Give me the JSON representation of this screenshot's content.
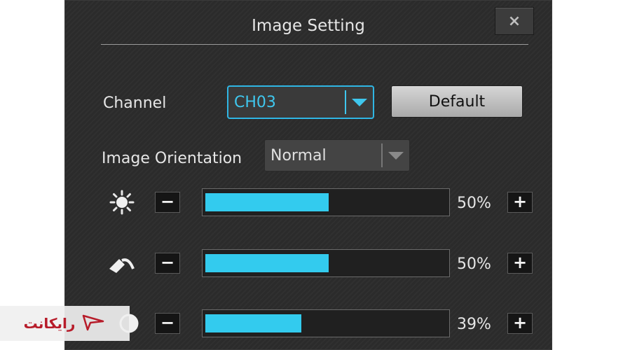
{
  "dialog": {
    "title": "Image Setting",
    "close_label": "×"
  },
  "channel": {
    "label": "Channel",
    "selected": "CH03",
    "default_button": "Default"
  },
  "orientation": {
    "label": "Image Orientation",
    "selected": "Normal"
  },
  "adjustments": [
    {
      "icon": "brightness-sun-icon",
      "percent_label": "50%",
      "level": 0.5,
      "minus": "−",
      "plus": "+"
    },
    {
      "icon": "contrast-icon",
      "percent_label": "50%",
      "level": 0.5,
      "minus": "−",
      "plus": "+"
    },
    {
      "icon": "saturation-half-circle-icon",
      "percent_label": "39%",
      "level": 0.39,
      "minus": "−",
      "plus": "+"
    }
  ],
  "watermark": {
    "text": "رایکانت"
  },
  "colors": {
    "accent": "#33cbee",
    "dialog_bg": "#2b2b2b",
    "text": "#e6e6e6",
    "watermark": "#b71c2a"
  }
}
